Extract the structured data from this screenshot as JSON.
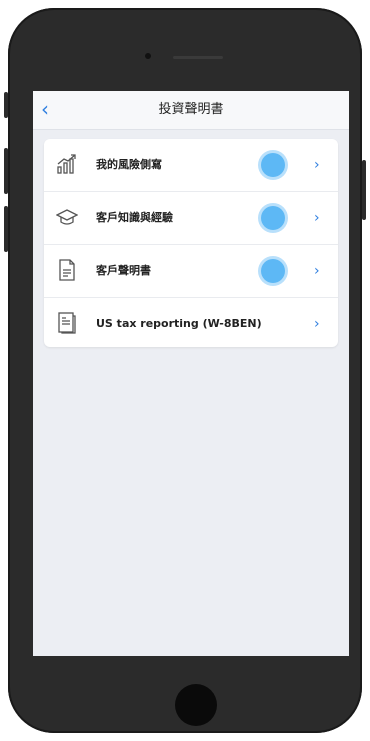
{
  "nav": {
    "back_icon": "‹",
    "title": "投資聲明書"
  },
  "rows": [
    {
      "label": "我的風險側寫",
      "icon": "growth-chart-icon",
      "status_dot": true
    },
    {
      "label": "客戶知識與經驗",
      "icon": "graduation-cap-icon",
      "status_dot": true
    },
    {
      "label": "客戶聲明書",
      "icon": "document-icon",
      "status_dot": true
    },
    {
      "label": "US tax reporting (W-8BEN)",
      "icon": "form-icon",
      "status_dot": false
    }
  ],
  "chevron": "›",
  "colors": {
    "accent": "#2f7fe0",
    "dot": "#5db8f5",
    "background": "#eceef3"
  }
}
